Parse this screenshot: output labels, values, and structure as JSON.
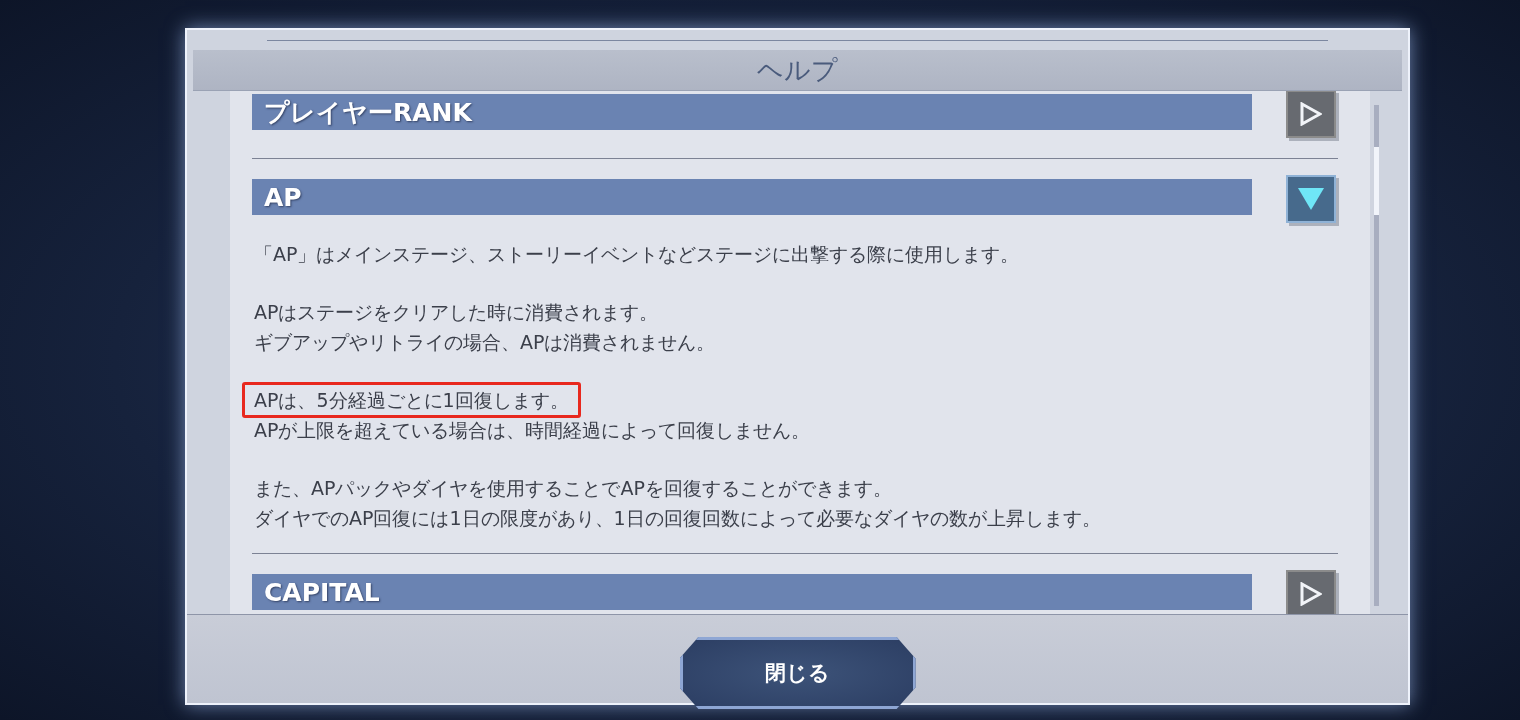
{
  "dialog": {
    "title": "ヘルプ",
    "sections": [
      {
        "title": "プレイヤーRANK",
        "expanded": false
      },
      {
        "title": "AP",
        "expanded": true,
        "paragraphs": [
          {
            "lines": [
              {
                "text": "「AP」はメインステージ、ストーリーイベントなどステージに出撃する際に使用します。",
                "highlighted": false
              }
            ]
          },
          {
            "lines": [
              {
                "text": "APはステージをクリアした時に消費されます。",
                "highlighted": false
              },
              {
                "text": "ギブアップやリトライの場合、APは消費されません。",
                "highlighted": false
              }
            ]
          },
          {
            "lines": [
              {
                "text": "APは、5分経過ごとに1回復します。",
                "highlighted": true
              },
              {
                "text": "APが上限を超えている場合は、時間経過によって回復しません。",
                "highlighted": false
              }
            ]
          },
          {
            "lines": [
              {
                "text": "また、APパックやダイヤを使用することでAPを回復することができます。",
                "highlighted": false
              },
              {
                "text": "ダイヤでのAP回復には1日の限度があり、1日の回復回数によって必要なダイヤの数が上昇します。",
                "highlighted": false
              }
            ]
          }
        ]
      },
      {
        "title": "CAPITAL",
        "expanded": false
      }
    ],
    "close_button": "閉じる"
  }
}
